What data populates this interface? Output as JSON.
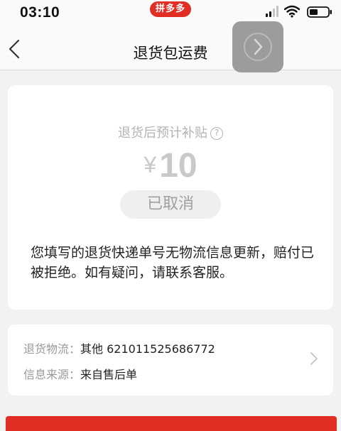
{
  "status_bar": {
    "time": "03:10",
    "app_badge": "拼多多",
    "signal": "signal-icon",
    "wifi": "wifi-icon",
    "battery": "battery-icon"
  },
  "nav": {
    "title": "退货包运费",
    "back_icon": "chevron-left-icon",
    "float_button_icon": "chevron-right-circle-icon"
  },
  "subsidy": {
    "label": "退货后预计补贴",
    "help_icon": "?",
    "currency": "¥",
    "amount": "10",
    "status": "已取消",
    "message": "您填写的退货快递单号无物流信息更新，赔付已被拒绝。如有疑问，请联系客服。"
  },
  "logistics": {
    "rows": [
      {
        "key": "退货物流：",
        "value": "其他 621011525686772"
      },
      {
        "key": "信息来源：",
        "value": "来自售后单"
      }
    ]
  },
  "colors": {
    "brand_red": "#e02e24",
    "muted_gray": "#b3b3b3"
  }
}
